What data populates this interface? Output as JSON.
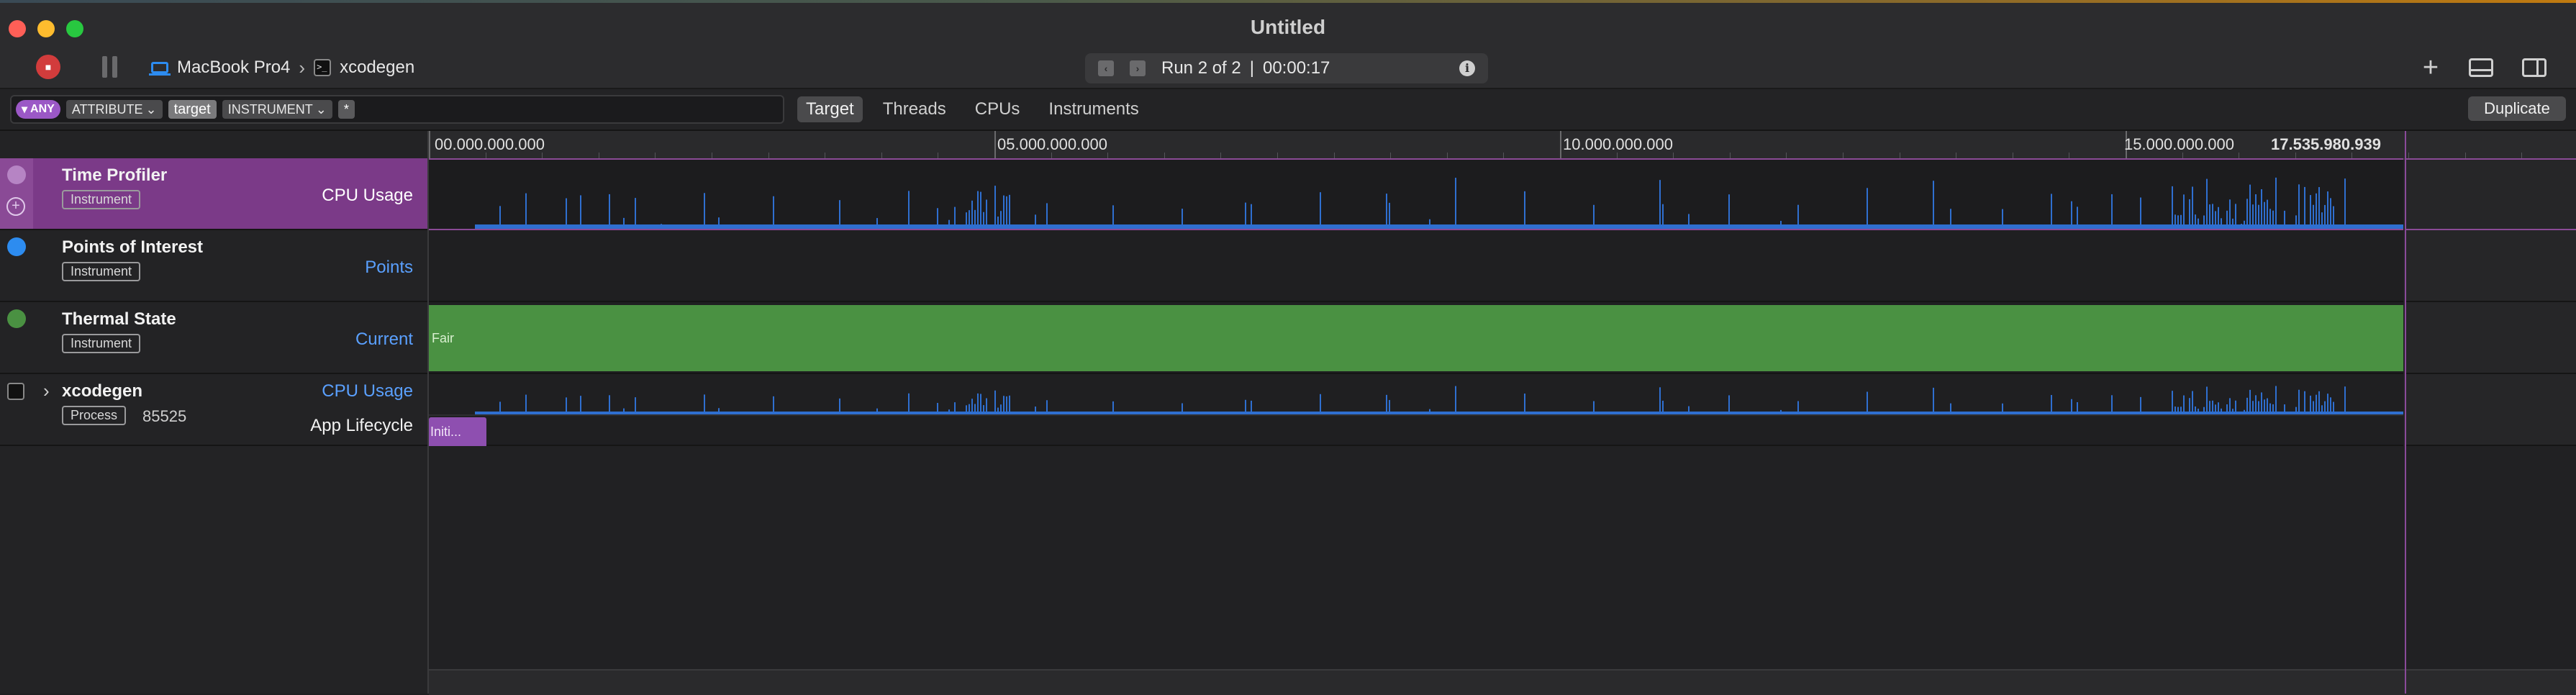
{
  "window": {
    "title": "Untitled"
  },
  "toolbar": {
    "device": "MacBook Pro4",
    "target": "xcodegen",
    "run_label": "Run 2 of 2",
    "separator": "|",
    "duration": "00:00:17"
  },
  "filter": {
    "any": "ANY",
    "attribute": "ATTRIBUTE",
    "target_token": "target",
    "instrument": "INSTRUMENT",
    "star": "*"
  },
  "scope_tabs": [
    "Target",
    "Threads",
    "CPUs",
    "Instruments"
  ],
  "duplicate_label": "Duplicate",
  "ruler": {
    "ticks": [
      "00.000.000.000",
      "05.000.000.000",
      "10.000.000.000",
      "15.000.000.000"
    ],
    "end_label": "17.535.980.939"
  },
  "tracks": [
    {
      "name": "Time Profiler",
      "badge": "Instrument",
      "sublabel": "CPU Usage"
    },
    {
      "name": "Points of Interest",
      "badge": "Instrument",
      "sublabel": "Points"
    },
    {
      "name": "Thermal State",
      "badge": "Instrument",
      "sublabel": "Current",
      "lane_text": "Fair"
    },
    {
      "name": "xcodegen",
      "badge": "Process",
      "pid": "85525",
      "sublabel": "CPU Usage",
      "sublabel2": "App Lifecycle",
      "lifecycle_text": "Initi..."
    }
  ],
  "colors": {
    "accent": "#7b3a88",
    "cpu": "#2f6fd0",
    "thermal": "#4a9142",
    "lifecycle": "#8e4fb0"
  }
}
